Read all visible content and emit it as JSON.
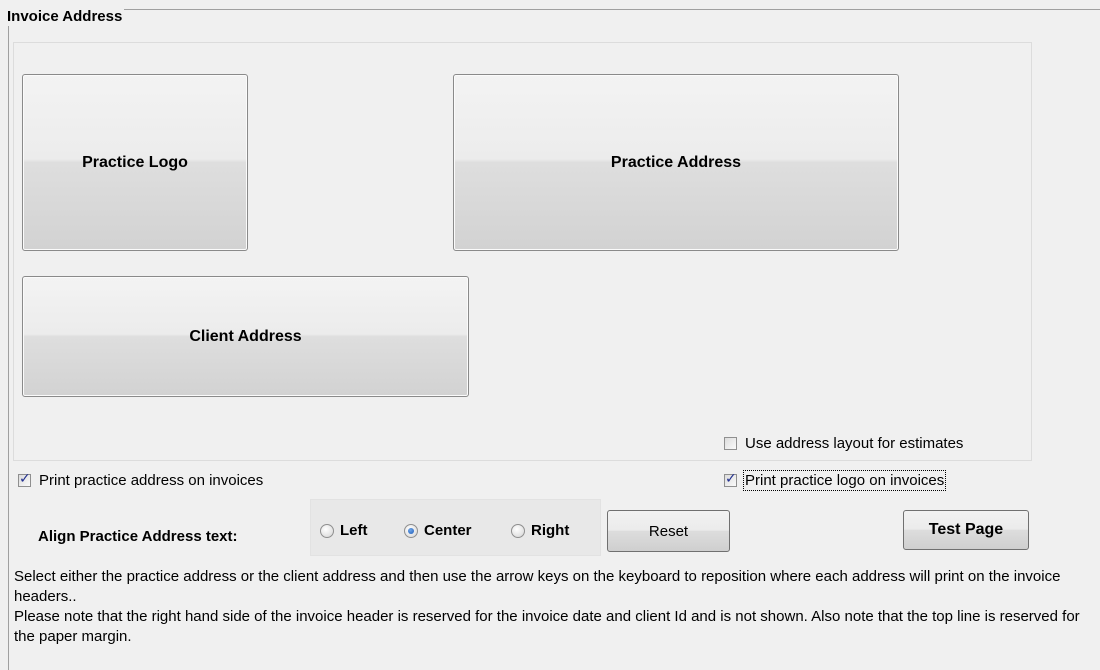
{
  "group": {
    "title": "Invoice Address"
  },
  "regions": {
    "practice_logo": "Practice Logo",
    "practice_address": "Practice Address",
    "client_address": "Client Address"
  },
  "checkboxes": {
    "use_address_layout": {
      "label": "Use address layout for estimates",
      "checked": false
    },
    "print_practice_address": {
      "label": "Print practice address on invoices",
      "checked": true
    },
    "print_practice_logo": {
      "label": "Print practice logo on invoices",
      "checked": true
    }
  },
  "alignment": {
    "label": "Align Practice Address text:",
    "options": [
      "Left",
      "Center",
      "Right"
    ],
    "selected": "Center"
  },
  "buttons": {
    "reset": "Reset",
    "test_page": "Test Page"
  },
  "info": {
    "line1": "Select either the practice address or the client address and then use the arrow keys on the keyboard to reposition where each address will print on the invoice headers..",
    "line2": "Please note that the right hand side of the invoice header is reserved for the invoice date and client Id and is not shown.  Also note that the top line is reserved for the paper margin."
  }
}
